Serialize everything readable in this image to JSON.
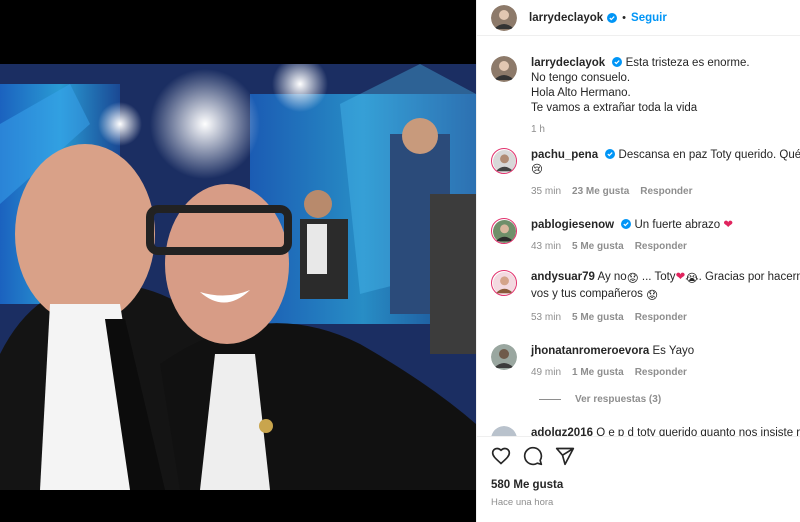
{
  "post": {
    "author": "larrydeclayok",
    "follow_label": "Seguir",
    "caption_lines": [
      "Esta tristeza es enorme.",
      "No tengo consuelo.",
      "Hola Alto Hermano.",
      "Te vamos a extrañar toda la vida"
    ],
    "caption_time": "1 h"
  },
  "comments": [
    {
      "user": "pachu_pena",
      "verified": true,
      "text_line1": "Descansa en paz Toty querido. Qué tri",
      "text_line2": "😢",
      "time": "35 min",
      "likes": "23 Me gusta",
      "reply": "Responder"
    },
    {
      "user": "pablogiesenow",
      "verified": true,
      "text": "Un fuerte abrazo",
      "text_emoji": "❤",
      "time": "43 min",
      "likes": "5 Me gusta",
      "reply": "Responder"
    },
    {
      "user": "andysuar79",
      "verified": false,
      "text_a": "Ay no",
      "text_b": " ... Toty",
      "text_c": ". Gracias por hacern",
      "text_line2": "vos y tus compañeros",
      "time": "53 min",
      "likes": "5 Me gusta",
      "reply": "Responder"
    },
    {
      "user": "jhonatanromeroevora",
      "verified": false,
      "text": "Es Yayo",
      "time": "49 min",
      "likes": "1 Me gusta",
      "reply": "Responder"
    },
    {
      "user": "adolgz2016",
      "verified": false,
      "text": "Q e p d toty querido quanto nos insiste ro"
    }
  ],
  "view_replies": "Ver respuestas (3)",
  "likes_total": "580 Me gusta",
  "posted_ago": "Hace una hora",
  "colors": {
    "accent": "#0095f6",
    "verified": "#0095f6",
    "heart": "#e0245e",
    "muted": "#8e8e8e"
  },
  "icons": [
    "verified-badge-icon",
    "heart-icon",
    "comment-icon",
    "share-icon"
  ]
}
